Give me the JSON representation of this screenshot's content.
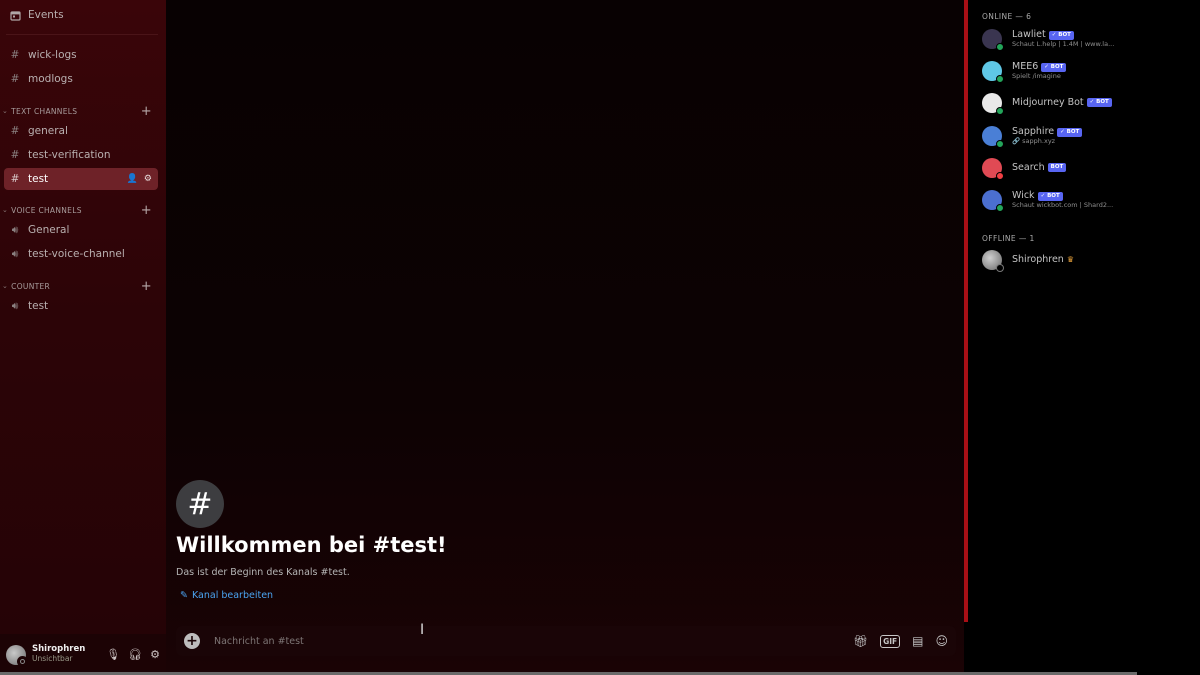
{
  "sidebar": {
    "events_label": "Events",
    "channels_top": [
      {
        "label": "wick-logs"
      },
      {
        "label": "modlogs"
      }
    ],
    "categories": [
      {
        "label": "TEXT CHANNELS"
      },
      {
        "label": "VOICE CHANNELS"
      },
      {
        "label": "COUNTER"
      }
    ],
    "text_channels": [
      {
        "label": "general"
      },
      {
        "label": "test-verification"
      },
      {
        "label": "test"
      }
    ],
    "voice_channels": [
      {
        "label": "General"
      },
      {
        "label": "test-voice-channel"
      }
    ],
    "counter_channels": [
      {
        "label": "test"
      }
    ]
  },
  "user": {
    "name": "Shirophren",
    "status": "Unsichtbar"
  },
  "main": {
    "welcome_title": "Willkommen bei #test!",
    "welcome_sub": "Das ist der Beginn des Kanals #test.",
    "edit_link": "Kanal bearbeiten",
    "composer_placeholder": "Nachricht an #test",
    "gif_label": "GIF"
  },
  "members": {
    "online_header": "ONLINE — 6",
    "offline_header": "OFFLINE — 1",
    "bot_label": "✓ BOT",
    "bot_label_plain": "BOT",
    "online": [
      {
        "name": "Lawliet",
        "activity": "Schaut L.help | 1.4M | www.la...",
        "bot": true,
        "avatar_color": "#3a3550",
        "status_color": "#23a55a"
      },
      {
        "name": "MEE6",
        "activity": "Spielt /imagine",
        "bot": true,
        "avatar_color": "#5fc8e6",
        "status_color": "#23a55a"
      },
      {
        "name": "Midjourney Bot",
        "activity": "",
        "bot": true,
        "avatar_color": "#e9e9e9",
        "status_color": "#23a55a"
      },
      {
        "name": "Sapphire",
        "activity": "🔗 sapph.xyz",
        "bot": true,
        "avatar_color": "#4a7fd6",
        "status_color": "#23a55a"
      },
      {
        "name": "Search",
        "activity": "",
        "bot": true,
        "bot_plain": true,
        "avatar_color": "#e04a54",
        "status_color": "#f23f43"
      },
      {
        "name": "Wick",
        "activity": "Schaut wickbot.com | Shard2...",
        "bot": true,
        "avatar_color": "#4b6fd0",
        "status_color": "#23a55a"
      }
    ],
    "offline": [
      {
        "name": "Shirophren",
        "crown": "♛"
      }
    ]
  }
}
